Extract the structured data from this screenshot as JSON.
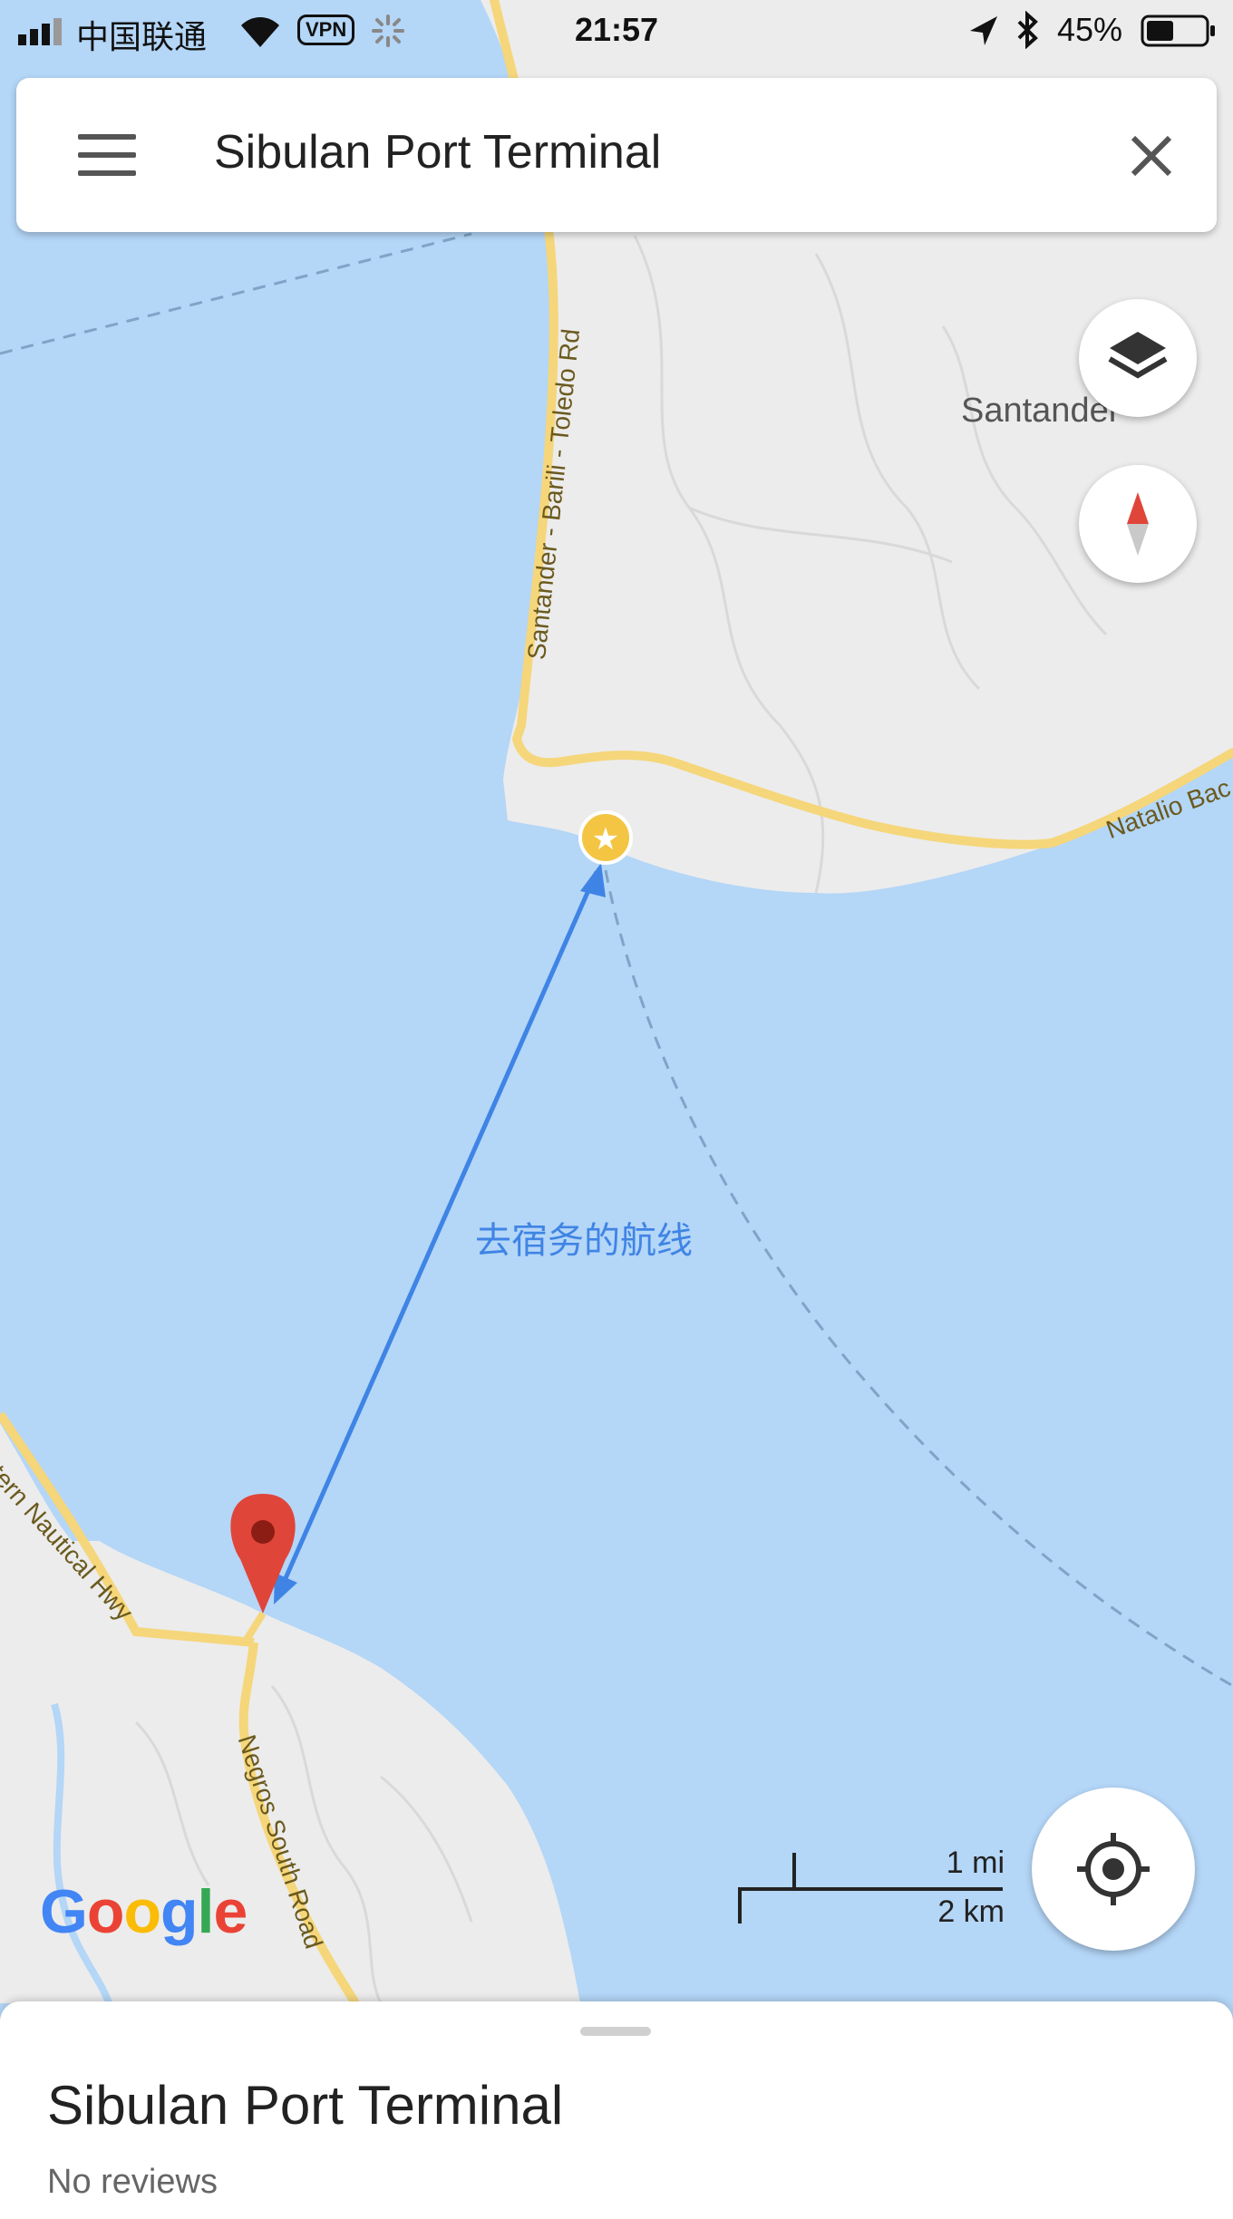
{
  "status_bar": {
    "carrier": "中国联通",
    "vpn": "VPN",
    "time": "21:57",
    "battery": "45%"
  },
  "search": {
    "query": "Sibulan Port Terminal",
    "menu_icon": "hamburger-menu-icon",
    "close_icon": "close-icon"
  },
  "map": {
    "place_label": "Santander",
    "route_label": "去宿务的航线",
    "roads": {
      "road_1": "Santander - Barili - Toledo Rd",
      "road_2": "Natalio Bac",
      "road_3": "tern Nautical Hwy",
      "road_4": "Negros South Road"
    },
    "controls": {
      "layers_icon": "layers-icon",
      "compass_icon": "compass-icon",
      "locate_icon": "my-location-icon"
    },
    "logo": "Google",
    "scale": {
      "imperial": "1 mi",
      "metric": "2 km"
    },
    "colors": {
      "water": "#b4d6f7",
      "land": "#ececec",
      "road": "#f5d67a",
      "route_arrow": "#3f84e5",
      "pin": "#e0453a",
      "star_marker": "#f4c543"
    }
  },
  "place_sheet": {
    "title": "Sibulan Port Terminal",
    "reviews": "No reviews"
  }
}
